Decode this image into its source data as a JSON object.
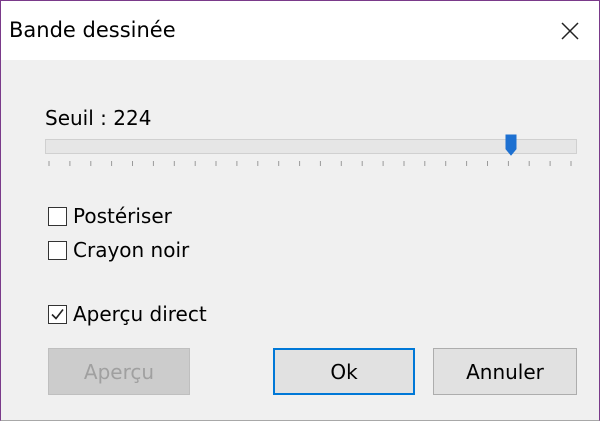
{
  "dialog": {
    "title": "Bande dessinée",
    "close_icon": "close-icon"
  },
  "threshold": {
    "label": "Seuil : 224",
    "value": 224,
    "min": 0,
    "max": 255,
    "tick_count": 26
  },
  "options": {
    "posterize": {
      "label": "Postériser",
      "checked": false
    },
    "black_pencil": {
      "label": "Crayon noir",
      "checked": false
    },
    "live_preview": {
      "label": "Aperçu direct",
      "checked": true
    }
  },
  "buttons": {
    "preview": {
      "label": "Aperçu",
      "enabled": false
    },
    "ok": {
      "label": "Ok"
    },
    "cancel": {
      "label": "Annuler"
    }
  },
  "colors": {
    "accent": "#0078d7",
    "thumb": "#1d70d1"
  }
}
